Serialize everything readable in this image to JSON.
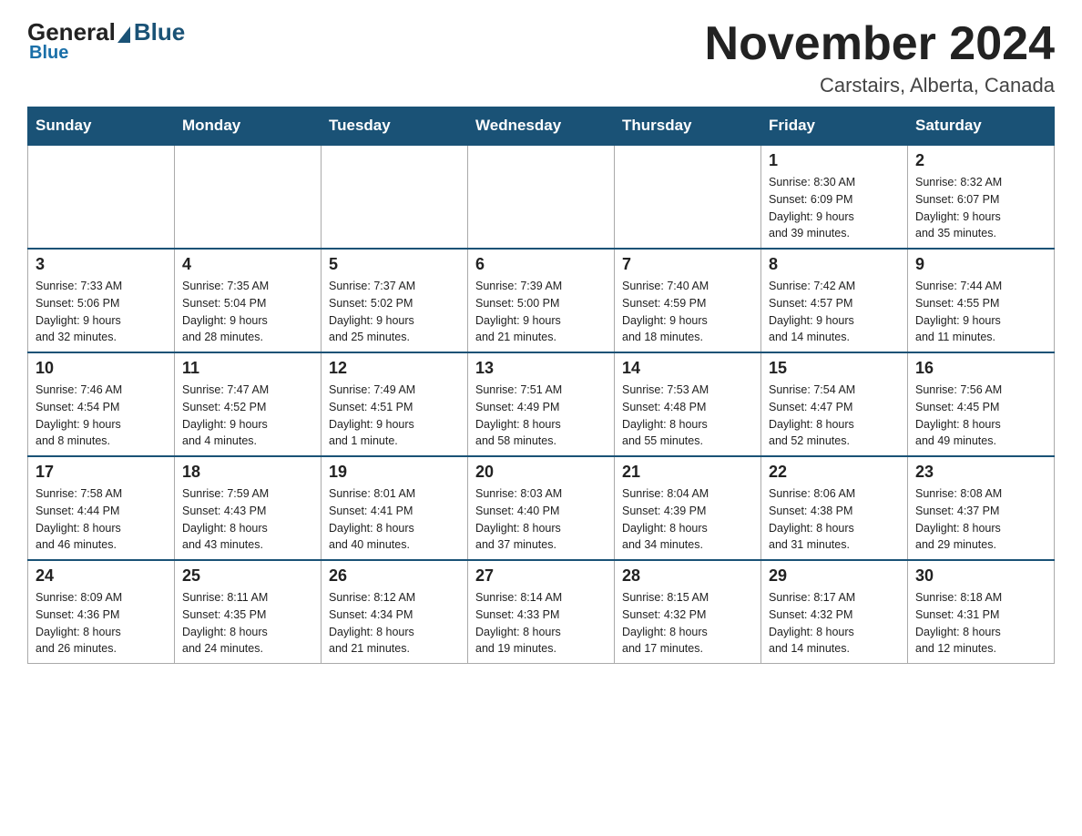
{
  "logo": {
    "general": "General",
    "blue": "Blue"
  },
  "header": {
    "month_title": "November 2024",
    "location": "Carstairs, Alberta, Canada"
  },
  "days_of_week": [
    "Sunday",
    "Monday",
    "Tuesday",
    "Wednesday",
    "Thursday",
    "Friday",
    "Saturday"
  ],
  "weeks": [
    [
      {
        "day": "",
        "info": ""
      },
      {
        "day": "",
        "info": ""
      },
      {
        "day": "",
        "info": ""
      },
      {
        "day": "",
        "info": ""
      },
      {
        "day": "",
        "info": ""
      },
      {
        "day": "1",
        "info": "Sunrise: 8:30 AM\nSunset: 6:09 PM\nDaylight: 9 hours\nand 39 minutes."
      },
      {
        "day": "2",
        "info": "Sunrise: 8:32 AM\nSunset: 6:07 PM\nDaylight: 9 hours\nand 35 minutes."
      }
    ],
    [
      {
        "day": "3",
        "info": "Sunrise: 7:33 AM\nSunset: 5:06 PM\nDaylight: 9 hours\nand 32 minutes."
      },
      {
        "day": "4",
        "info": "Sunrise: 7:35 AM\nSunset: 5:04 PM\nDaylight: 9 hours\nand 28 minutes."
      },
      {
        "day": "5",
        "info": "Sunrise: 7:37 AM\nSunset: 5:02 PM\nDaylight: 9 hours\nand 25 minutes."
      },
      {
        "day": "6",
        "info": "Sunrise: 7:39 AM\nSunset: 5:00 PM\nDaylight: 9 hours\nand 21 minutes."
      },
      {
        "day": "7",
        "info": "Sunrise: 7:40 AM\nSunset: 4:59 PM\nDaylight: 9 hours\nand 18 minutes."
      },
      {
        "day": "8",
        "info": "Sunrise: 7:42 AM\nSunset: 4:57 PM\nDaylight: 9 hours\nand 14 minutes."
      },
      {
        "day": "9",
        "info": "Sunrise: 7:44 AM\nSunset: 4:55 PM\nDaylight: 9 hours\nand 11 minutes."
      }
    ],
    [
      {
        "day": "10",
        "info": "Sunrise: 7:46 AM\nSunset: 4:54 PM\nDaylight: 9 hours\nand 8 minutes."
      },
      {
        "day": "11",
        "info": "Sunrise: 7:47 AM\nSunset: 4:52 PM\nDaylight: 9 hours\nand 4 minutes."
      },
      {
        "day": "12",
        "info": "Sunrise: 7:49 AM\nSunset: 4:51 PM\nDaylight: 9 hours\nand 1 minute."
      },
      {
        "day": "13",
        "info": "Sunrise: 7:51 AM\nSunset: 4:49 PM\nDaylight: 8 hours\nand 58 minutes."
      },
      {
        "day": "14",
        "info": "Sunrise: 7:53 AM\nSunset: 4:48 PM\nDaylight: 8 hours\nand 55 minutes."
      },
      {
        "day": "15",
        "info": "Sunrise: 7:54 AM\nSunset: 4:47 PM\nDaylight: 8 hours\nand 52 minutes."
      },
      {
        "day": "16",
        "info": "Sunrise: 7:56 AM\nSunset: 4:45 PM\nDaylight: 8 hours\nand 49 minutes."
      }
    ],
    [
      {
        "day": "17",
        "info": "Sunrise: 7:58 AM\nSunset: 4:44 PM\nDaylight: 8 hours\nand 46 minutes."
      },
      {
        "day": "18",
        "info": "Sunrise: 7:59 AM\nSunset: 4:43 PM\nDaylight: 8 hours\nand 43 minutes."
      },
      {
        "day": "19",
        "info": "Sunrise: 8:01 AM\nSunset: 4:41 PM\nDaylight: 8 hours\nand 40 minutes."
      },
      {
        "day": "20",
        "info": "Sunrise: 8:03 AM\nSunset: 4:40 PM\nDaylight: 8 hours\nand 37 minutes."
      },
      {
        "day": "21",
        "info": "Sunrise: 8:04 AM\nSunset: 4:39 PM\nDaylight: 8 hours\nand 34 minutes."
      },
      {
        "day": "22",
        "info": "Sunrise: 8:06 AM\nSunset: 4:38 PM\nDaylight: 8 hours\nand 31 minutes."
      },
      {
        "day": "23",
        "info": "Sunrise: 8:08 AM\nSunset: 4:37 PM\nDaylight: 8 hours\nand 29 minutes."
      }
    ],
    [
      {
        "day": "24",
        "info": "Sunrise: 8:09 AM\nSunset: 4:36 PM\nDaylight: 8 hours\nand 26 minutes."
      },
      {
        "day": "25",
        "info": "Sunrise: 8:11 AM\nSunset: 4:35 PM\nDaylight: 8 hours\nand 24 minutes."
      },
      {
        "day": "26",
        "info": "Sunrise: 8:12 AM\nSunset: 4:34 PM\nDaylight: 8 hours\nand 21 minutes."
      },
      {
        "day": "27",
        "info": "Sunrise: 8:14 AM\nSunset: 4:33 PM\nDaylight: 8 hours\nand 19 minutes."
      },
      {
        "day": "28",
        "info": "Sunrise: 8:15 AM\nSunset: 4:32 PM\nDaylight: 8 hours\nand 17 minutes."
      },
      {
        "day": "29",
        "info": "Sunrise: 8:17 AM\nSunset: 4:32 PM\nDaylight: 8 hours\nand 14 minutes."
      },
      {
        "day": "30",
        "info": "Sunrise: 8:18 AM\nSunset: 4:31 PM\nDaylight: 8 hours\nand 12 minutes."
      }
    ]
  ]
}
